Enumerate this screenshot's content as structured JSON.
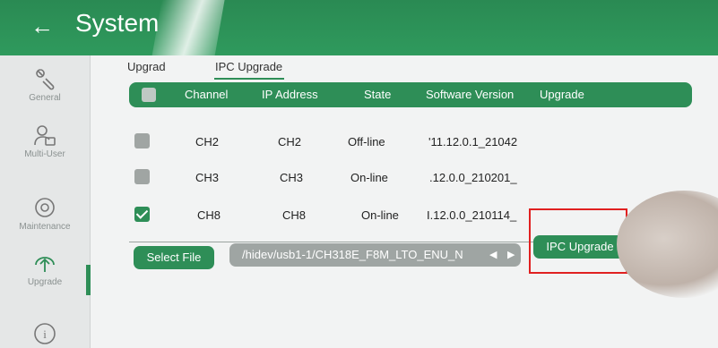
{
  "header": {
    "title": "System"
  },
  "sidebar": {
    "items": [
      {
        "label": "General",
        "icon": "wrench-icon"
      },
      {
        "label": "Multi-User",
        "icon": "user-icon"
      },
      {
        "label": "Maintenance",
        "icon": "maintenance-icon"
      },
      {
        "label": "Upgrade",
        "icon": "upgrade-icon",
        "active": true
      },
      {
        "label": "",
        "icon": "info-icon"
      }
    ]
  },
  "tabs": [
    {
      "label": "Upgrad"
    },
    {
      "label": "IPC Upgrade",
      "active": true
    }
  ],
  "table": {
    "columns": [
      "Channel",
      "IP Address",
      "State",
      "Software Version",
      "Upgrade"
    ],
    "rows": [
      {
        "checked": false,
        "channel": "CH2",
        "ip": "CH2",
        "state": "Off-line",
        "version": "'11.12.0.1_21042"
      },
      {
        "checked": false,
        "channel": "CH3",
        "ip": "CH3",
        "state": "On-line",
        "version": ".12.0.0_210201_"
      },
      {
        "checked": true,
        "channel": "CH8",
        "ip": "CH8",
        "state": "On-line",
        "version": "I.12.0.0_210114_"
      }
    ]
  },
  "footer": {
    "select_file_label": "Select File",
    "file_path": "/hidev/usb1-1/CH318E_F8M_LTO_ENU_N",
    "ipc_upgrade_label": "IPC Upgrade"
  },
  "colors": {
    "accent": "#2e8e57",
    "highlight": "#e02020"
  }
}
